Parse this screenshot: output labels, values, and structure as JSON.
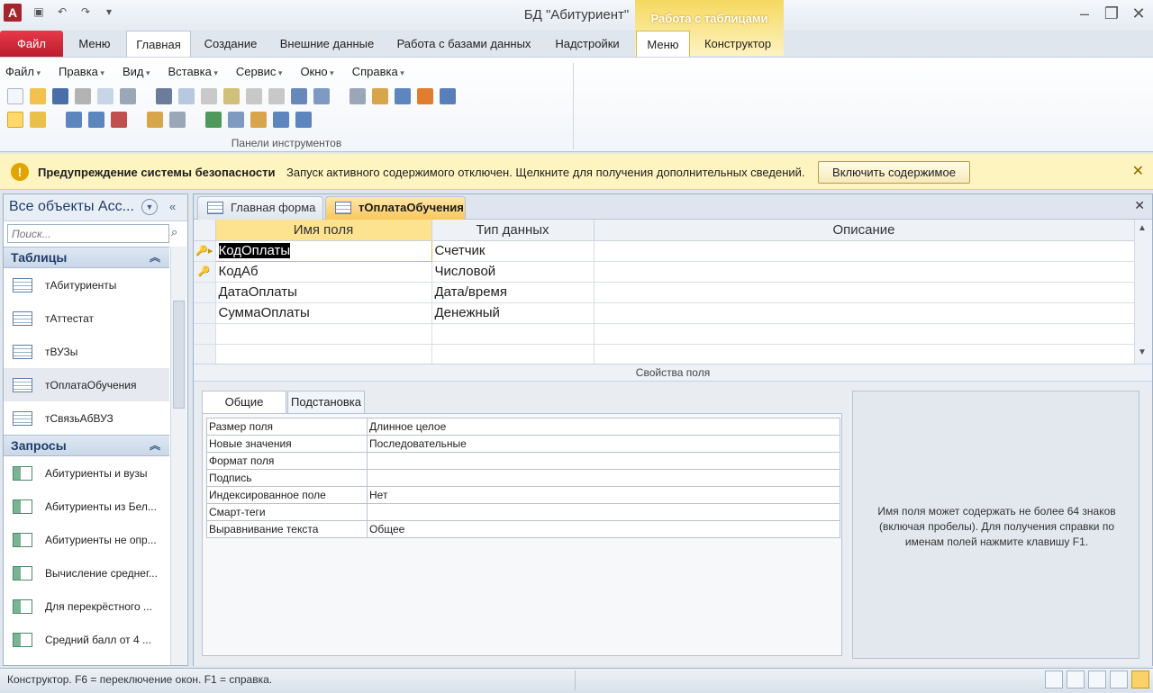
{
  "window": {
    "title": "БД \"Абитуриент\"",
    "context_header": "Работа с таблицами"
  },
  "ribbon_tabs": [
    "Файл",
    "Меню",
    "Главная",
    "Создание",
    "Внешние данные",
    "Работа с базами данных",
    "Надстройки",
    "Меню",
    "Конструктор"
  ],
  "menubar": [
    "Файл",
    "Правка",
    "Вид",
    "Вставка",
    "Сервис",
    "Окно",
    "Справка"
  ],
  "toolbar_group_label": "Панели инструментов",
  "security": {
    "title": "Предупреждение системы безопасности",
    "message": "Запуск активного содержимого отключен. Щелкните для получения дополнительных сведений.",
    "button": "Включить содержимое",
    "close": "✕"
  },
  "nav": {
    "title": "Все объекты Acc...",
    "search_placeholder": "Поиск...",
    "groups": [
      {
        "label": "Таблицы",
        "items": [
          "тАбитуриенты",
          "тАттестат",
          "тВУЗы",
          "тОплатаОбучения",
          "тСвязьАбВУЗ"
        ]
      },
      {
        "label": "Запросы",
        "items": [
          "Абитуриенты и вузы",
          "Абитуриенты из Бел...",
          "Абитуриенты не опр...",
          "Вычисление среднег...",
          "Для перекрёстного ...",
          "Средний балл от 4 ..."
        ]
      }
    ]
  },
  "doc_tabs": [
    "Главная форма",
    "тОплатаОбучения"
  ],
  "design_grid": {
    "headers": [
      "Имя поля",
      "Тип данных",
      "Описание"
    ],
    "rows": [
      {
        "name": "КодОплаты",
        "type": "Счетчик",
        "desc": ""
      },
      {
        "name": "КодАб",
        "type": "Числовой",
        "desc": ""
      },
      {
        "name": "ДатаОплаты",
        "type": "Дата/время",
        "desc": ""
      },
      {
        "name": "СуммаОплаты",
        "type": "Денежный",
        "desc": ""
      }
    ]
  },
  "field_props": {
    "label": "Свойства поля",
    "tabs": [
      "Общие",
      "Подстановка"
    ],
    "rows": [
      {
        "k": "Размер поля",
        "v": "Длинное целое"
      },
      {
        "k": "Новые значения",
        "v": "Последовательные"
      },
      {
        "k": "Формат поля",
        "v": ""
      },
      {
        "k": "Подпись",
        "v": ""
      },
      {
        "k": "Индексированное поле",
        "v": "Нет"
      },
      {
        "k": "Смарт-теги",
        "v": ""
      },
      {
        "k": "Выравнивание текста",
        "v": "Общее"
      }
    ],
    "help": "Имя поля может содержать не более 64 знаков (включая пробелы). Для получения справки по именам полей нажмите клавишу F1."
  },
  "status": {
    "text": "Конструктор.  F6 = переключение окон.  F1 = справка."
  }
}
